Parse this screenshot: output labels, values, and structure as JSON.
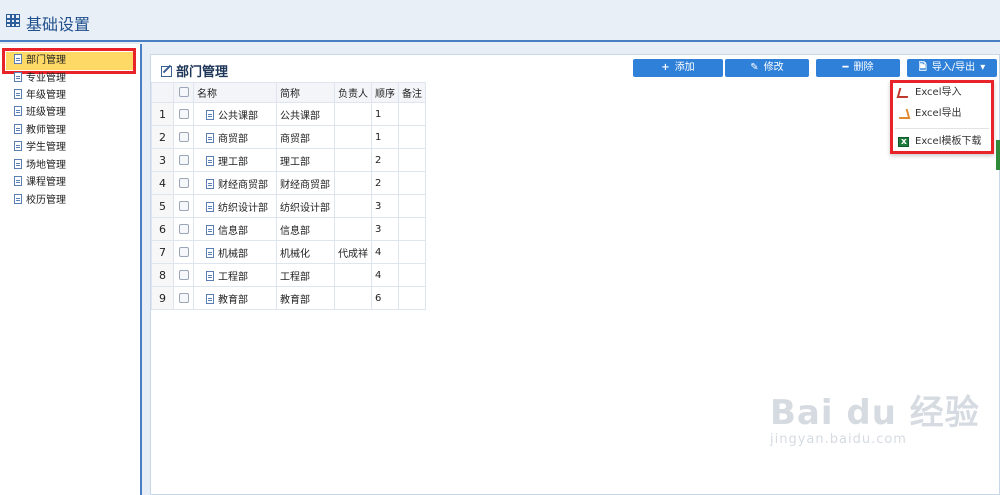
{
  "header": {
    "title": "基础设置",
    "icon": "table-icon"
  },
  "sidebar": {
    "items": [
      {
        "label": "部门管理",
        "active": true
      },
      {
        "label": "专业管理"
      },
      {
        "label": "年级管理"
      },
      {
        "label": "班级管理"
      },
      {
        "label": "教师管理"
      },
      {
        "label": "学生管理"
      },
      {
        "label": "场地管理"
      },
      {
        "label": "课程管理"
      },
      {
        "label": "校历管理"
      }
    ]
  },
  "panel": {
    "title": "部门管理",
    "toolbar": {
      "add": "添加",
      "edit": "修改",
      "delete": "删除",
      "import_export": "导入/导出"
    },
    "columns": [
      "名称",
      "简称",
      "负责人",
      "顺序",
      "备注"
    ],
    "rows": [
      {
        "no": "1",
        "name": "公共课部",
        "short": "公共课部",
        "head": "",
        "order": "1",
        "note": ""
      },
      {
        "no": "2",
        "name": "商贸部",
        "short": "商贸部",
        "head": "",
        "order": "1",
        "note": ""
      },
      {
        "no": "3",
        "name": "理工部",
        "short": "理工部",
        "head": "",
        "order": "2",
        "note": ""
      },
      {
        "no": "4",
        "name": "财经商贸部",
        "short": "财经商贸部",
        "head": "",
        "order": "2",
        "note": ""
      },
      {
        "no": "5",
        "name": "纺织设计部",
        "short": "纺织设计部",
        "head": "",
        "order": "3",
        "note": ""
      },
      {
        "no": "6",
        "name": "信息部",
        "short": "信息部",
        "head": "",
        "order": "3",
        "note": ""
      },
      {
        "no": "7",
        "name": "机械部",
        "short": "机械化",
        "head": "代成祥",
        "order": "4",
        "note": ""
      },
      {
        "no": "8",
        "name": "工程部",
        "short": "工程部",
        "head": "",
        "order": "4",
        "note": ""
      },
      {
        "no": "9",
        "name": "教育部",
        "short": "教育部",
        "head": "",
        "order": "6",
        "note": ""
      }
    ]
  },
  "dropdown": {
    "items": [
      {
        "label": "Excel导入",
        "icon": "import-icon"
      },
      {
        "label": "Excel导出",
        "icon": "export-icon"
      },
      {
        "label": "Excel模板下载",
        "icon": "excel-icon"
      }
    ]
  },
  "watermark": {
    "logo": "Bai du 经验",
    "url": "jingyan.baidu.com"
  },
  "colors": {
    "accent": "#2f80d9",
    "highlight_border": "#e8242a",
    "active_bg": "#ffd966",
    "header_text": "#1f4f8c"
  }
}
